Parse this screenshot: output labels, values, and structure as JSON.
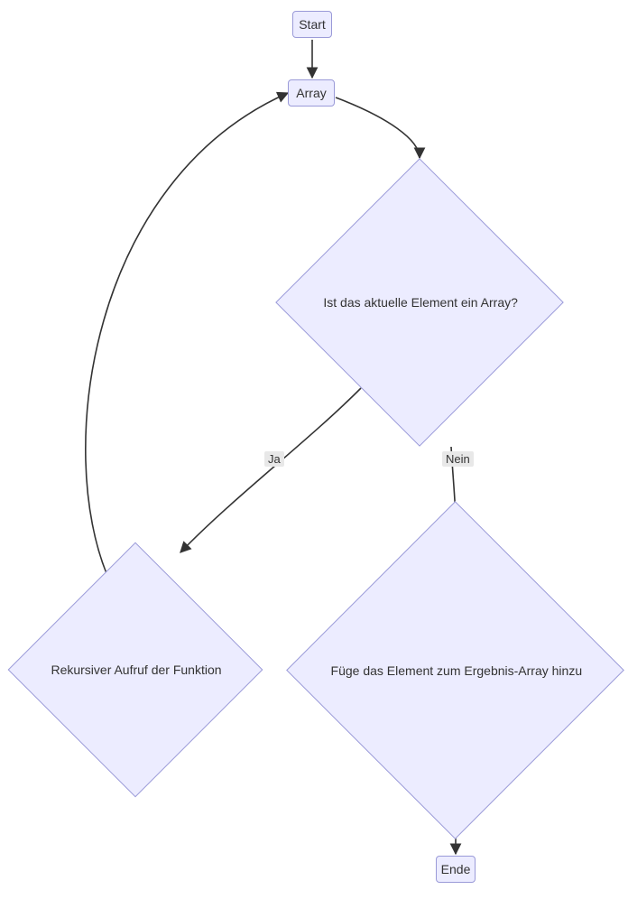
{
  "nodes": {
    "start": "Start",
    "array": "Array",
    "decision": "Ist das aktuelle Element ein Array?",
    "recurse": "Rekursiver Aufruf der Funktion",
    "append": "Füge das Element zum Ergebnis-Array hinzu",
    "end": "Ende"
  },
  "edges": {
    "yes": "Ja",
    "no": "Nein"
  },
  "colors": {
    "node_fill": "#ececff",
    "node_stroke": "#9a9ad8",
    "edge_stroke": "#333333"
  }
}
